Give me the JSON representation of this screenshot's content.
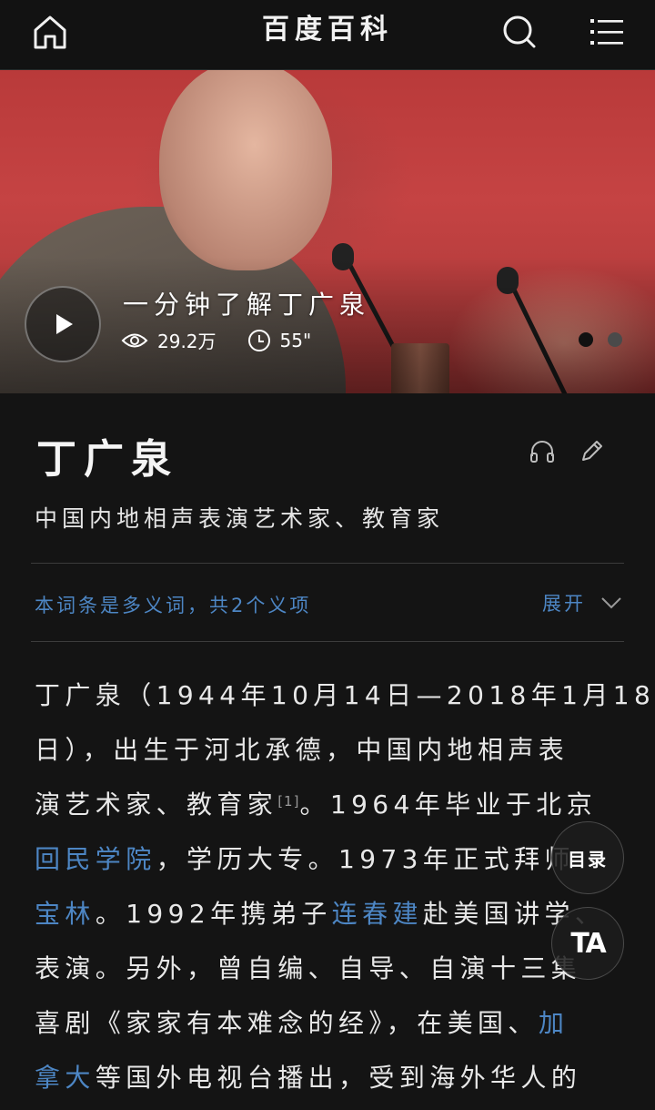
{
  "header": {
    "title": "百度百科",
    "home_icon": "home-icon",
    "search_icon": "search-icon",
    "menu_icon": "menu-icon"
  },
  "video": {
    "title": "一分钟了解丁广泉",
    "views": "29.2万",
    "duration": "55\"",
    "carousel_total": 2,
    "carousel_active": 1
  },
  "entry": {
    "title": "丁广泉",
    "description": "中国内地相声表演艺术家、教育家",
    "polysemy_text": "本词条是多义词，共2个义项",
    "expand_label": "展开"
  },
  "paragraph": {
    "lines": [
      [
        {
          "t": "丁广泉（1944年10月14日—2018年1月18"
        }
      ],
      [
        {
          "t": "日），出生于河北承德，中国内地相声表"
        }
      ],
      [
        {
          "t": "演艺术家、教育家"
        },
        {
          "sup": "[1]"
        },
        {
          "t": "。1964年毕业于北京"
        }
      ],
      [
        {
          "link": "回民学院"
        },
        {
          "t": "，学历大专。1973年正式拜师"
        }
      ],
      [
        {
          "link": "宝林"
        },
        {
          "t": "。1992年携弟子"
        },
        {
          "link": "连春建"
        },
        {
          "t": "赴美国讲学、"
        }
      ],
      [
        {
          "t": "表演。另外，曾自编、自导、自演十三集"
        }
      ],
      [
        {
          "t": "喜剧《家家有本难念的经》，在美国、"
        },
        {
          "link": "加"
        }
      ],
      [
        {
          "link": "拿大"
        },
        {
          "t": "等国外电视台播出，受到海外华人的"
        }
      ]
    ]
  },
  "floating": {
    "toc_label": "目录",
    "ta_label": "TA"
  },
  "colors": {
    "background": "#141414",
    "link": "#4d86c4",
    "text": "#e8e8e8"
  }
}
